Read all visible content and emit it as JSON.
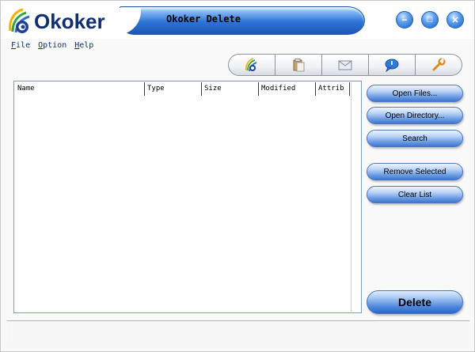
{
  "app": {
    "logo_text": "Okoker",
    "title": "Okoker Delete"
  },
  "window_controls": {
    "minimize_glyph": "−",
    "maximize_glyph": "□",
    "close_glyph": "✕"
  },
  "menu": {
    "items": [
      {
        "label": "File",
        "accel": "F",
        "rest": "ile"
      },
      {
        "label": "Option",
        "accel": "O",
        "rest": "ption"
      },
      {
        "label": "Help",
        "accel": "H",
        "rest": "elp"
      }
    ]
  },
  "toolbar": {
    "tabs": [
      {
        "icon": "logo-icon"
      },
      {
        "icon": "clipboard-icon"
      },
      {
        "icon": "email-icon"
      },
      {
        "icon": "chat-bubble-icon"
      },
      {
        "icon": "wrench-icon"
      }
    ]
  },
  "file_list": {
    "columns": [
      "Name",
      "Type",
      "Size",
      "Modified",
      "Attrib"
    ],
    "rows": []
  },
  "actions": {
    "open_files": "Open Files...",
    "open_directory": "Open Directory...",
    "search": "Search",
    "remove_selected": "Remove Selected",
    "clear_list": "Clear List",
    "delete": "Delete"
  },
  "colors": {
    "accent": "#2e74d6",
    "brand_text": "#0f2f73",
    "menu_text": "#0f2e80"
  }
}
